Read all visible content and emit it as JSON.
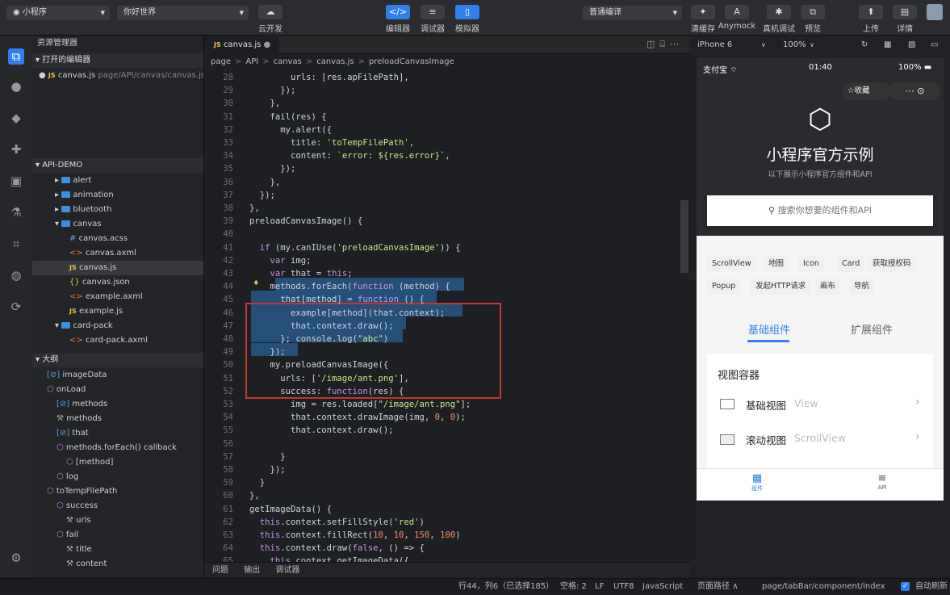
{
  "top": {
    "project": "小程序",
    "page": "你好世界",
    "cloud_label": "云开发",
    "editor_label": "编辑器",
    "debugger_label": "调试器",
    "simulator_label": "模拟器",
    "compile_mode": "普通编译",
    "clear_cache": "清缓存",
    "anymock": "Anymock",
    "real_debug": "真机调试",
    "preview": "预览",
    "upload": "上传",
    "details": "详情"
  },
  "side": {
    "explorer_title": "资源管理器",
    "open_editors": "打开的编辑器",
    "open_file": "canvas.js",
    "open_file_path": "page/API/canvas/canvas.js",
    "project": "API-DEMO",
    "outline": "大纲",
    "tree": [
      {
        "label": "alert",
        "icon": "folder",
        "indent": 1
      },
      {
        "label": "animation",
        "icon": "folder",
        "indent": 1
      },
      {
        "label": "bluetooth",
        "icon": "folder",
        "indent": 1
      },
      {
        "label": "canvas",
        "icon": "folder-open",
        "indent": 1
      },
      {
        "label": "canvas.acss",
        "icon": "hash",
        "indent": 2
      },
      {
        "label": "canvas.axml",
        "icon": "xml",
        "indent": 2
      },
      {
        "label": "canvas.js",
        "icon": "js",
        "indent": 2
      },
      {
        "label": "canvas.json",
        "icon": "json",
        "indent": 2
      },
      {
        "label": "example.axml",
        "icon": "xml",
        "indent": 2
      },
      {
        "label": "example.js",
        "icon": "js",
        "indent": 2
      },
      {
        "label": "card-pack",
        "icon": "folder-open",
        "indent": 1
      },
      {
        "label": "card-pack.axml",
        "icon": "xml",
        "indent": 2
      }
    ],
    "outline_items": [
      {
        "label": "imageData",
        "icon": "var",
        "indent": 1
      },
      {
        "label": "onLoad",
        "icon": "cube",
        "indent": 1
      },
      {
        "label": "methods",
        "icon": "var",
        "indent": 2
      },
      {
        "label": "methods",
        "icon": "wrench",
        "indent": 2
      },
      {
        "label": "that",
        "icon": "var",
        "indent": 2
      },
      {
        "label": "methods.forEach() callback",
        "icon": "cube",
        "indent": 2
      },
      {
        "label": "[method]",
        "icon": "cube",
        "indent": 3
      },
      {
        "label": "log",
        "icon": "cube",
        "indent": 2
      },
      {
        "label": "toTempFilePath",
        "icon": "cube",
        "indent": 1
      },
      {
        "label": "success",
        "icon": "cube",
        "indent": 2
      },
      {
        "label": "urls",
        "icon": "wrench",
        "indent": 3
      },
      {
        "label": "fail",
        "icon": "cube",
        "indent": 2
      },
      {
        "label": "title",
        "icon": "wrench",
        "indent": 3
      },
      {
        "label": "content",
        "icon": "wrench",
        "indent": 3
      }
    ]
  },
  "editor": {
    "tab": "canvas.js",
    "breadcrumb": [
      "page",
      "API",
      "canvas",
      "canvas.js",
      "preloadCanvasImage"
    ],
    "lines": [
      {
        "n": "28",
        "t": "        urls: [res.apFilePath],"
      },
      {
        "n": "29",
        "t": "      });"
      },
      {
        "n": "30",
        "t": "    },"
      },
      {
        "n": "31",
        "t": "    fail(res) {"
      },
      {
        "n": "32",
        "t": "      my.alert({"
      },
      {
        "n": "33",
        "t": "        title: 'toTempFilePath',"
      },
      {
        "n": "34",
        "t": "        content: `error: ${res.error}`,"
      },
      {
        "n": "35",
        "t": "      });"
      },
      {
        "n": "36",
        "t": "    },"
      },
      {
        "n": "37",
        "t": "  });"
      },
      {
        "n": "38",
        "t": "},"
      },
      {
        "n": "39",
        "t": "preloadCanvasImage() {"
      },
      {
        "n": "40",
        "t": ""
      },
      {
        "n": "41",
        "t": "  if (my.canIUse('preloadCanvasImage')) {"
      },
      {
        "n": "42",
        "t": "    var img;"
      },
      {
        "n": "43",
        "t": "    var that = this;"
      },
      {
        "n": "44",
        "t": "    methods.forEach(function (method) {"
      },
      {
        "n": "45",
        "t": "      that[method] = function () {"
      },
      {
        "n": "46",
        "t": "        example[method](that.context);"
      },
      {
        "n": "47",
        "t": "        that.context.draw();"
      },
      {
        "n": "48",
        "t": "      }; console.log(\"abc\")"
      },
      {
        "n": "49",
        "t": "    });"
      },
      {
        "n": "50",
        "t": "    my.preloadCanvasImage({"
      },
      {
        "n": "51",
        "t": "      urls: ['/image/ant.png'],"
      },
      {
        "n": "52",
        "t": "      success: function(res) {"
      },
      {
        "n": "53",
        "t": "        img = res.loaded[\"/image/ant.png\"];"
      },
      {
        "n": "54",
        "t": "        that.context.drawImage(img, 0, 0);"
      },
      {
        "n": "55",
        "t": "        that.context.draw();"
      },
      {
        "n": "56",
        "t": ""
      },
      {
        "n": "57",
        "t": "      }"
      },
      {
        "n": "58",
        "t": "    });"
      },
      {
        "n": "59",
        "t": "  }"
      },
      {
        "n": "60",
        "t": "},"
      },
      {
        "n": "61",
        "t": "getImageData() {"
      },
      {
        "n": "62",
        "t": "  this.context.setFillStyle('red')"
      },
      {
        "n": "63",
        "t": "  this.context.fillRect(10, 10, 150, 100)"
      },
      {
        "n": "64",
        "t": "  this.context.draw(false, () => {"
      },
      {
        "n": "65",
        "t": "    this.context.getImageData({"
      }
    ],
    "bottom_tabs": [
      "问题",
      "输出",
      "调试器"
    ]
  },
  "status": {
    "cursor": "行44，列6（已选择185）",
    "spaces": "空格: 2",
    "eol": "LF",
    "encoding": "UTF8",
    "lang": "JavaScript",
    "page_path_label": "页面路径",
    "page_path": "page/tabBar/component/index",
    "auto_refresh": "自动刷新"
  },
  "sim": {
    "device": "iPhone 6",
    "zoom": "100%",
    "carrier": "支付宝",
    "time": "01:40",
    "battery": "100%",
    "favorite": "收藏",
    "title": "小程序官方示例",
    "subtitle": "以下展示小程序官方组件和API",
    "search": "搜索你想要的组件和API",
    "chips": [
      "ScrollView",
      "地图",
      "Icon",
      "Card",
      "获取授权码",
      "Popup",
      "发起HTTP请求",
      "画布",
      "导航"
    ],
    "tab_basic": "基础组件",
    "tab_ext": "扩展组件",
    "section": "视图容器",
    "list": [
      {
        "cn": "基础视图",
        "en": "View"
      },
      {
        "cn": "滚动视图",
        "en": "ScrollView"
      }
    ],
    "nav_comp": "组件",
    "nav_api": "API"
  }
}
